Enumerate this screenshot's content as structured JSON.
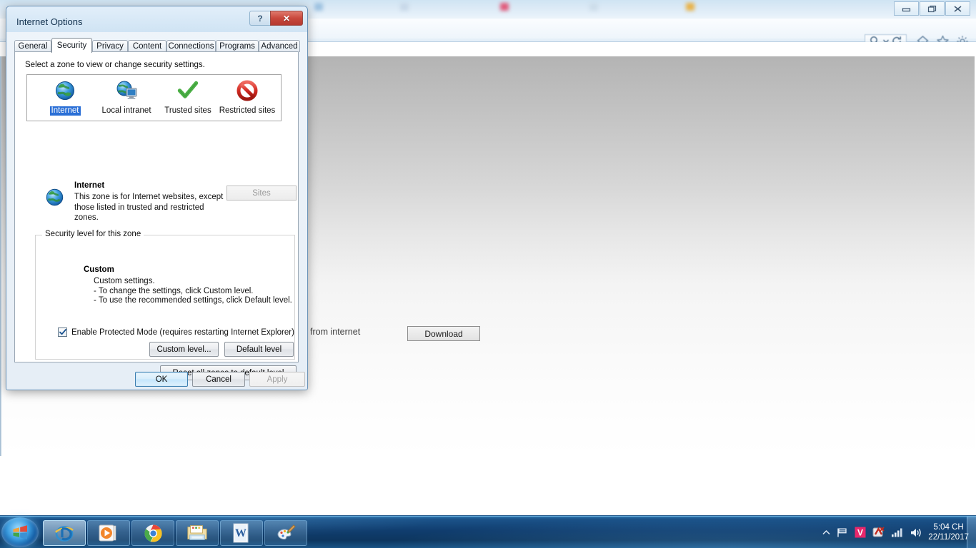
{
  "browser": {
    "window_controls": [
      {
        "name": "minimize",
        "glyph": "–"
      },
      {
        "name": "restore",
        "glyph": "❐"
      },
      {
        "name": "close",
        "glyph": "✕"
      }
    ],
    "tabs": [
      {
        "label": "",
        "blurred": true
      },
      {
        "label": "",
        "blurred": true
      },
      {
        "label": "",
        "blurred": true
      },
      {
        "label": "",
        "blurred": true
      },
      {
        "label": "",
        "blurred": true
      }
    ],
    "toolbar_icons": [
      "search-icon",
      "chevron-down-icon",
      "refresh-icon",
      "home-icon",
      "favorites-star-icon",
      "settings-gear-icon"
    ]
  },
  "page": {
    "text_fragment": "from internet",
    "download_button": "Download"
  },
  "dialog": {
    "title": "Internet Options",
    "caption_buttons": {
      "help": "?",
      "close": "✕"
    },
    "tabs": [
      {
        "label": "General",
        "active": false
      },
      {
        "label": "Security",
        "active": true
      },
      {
        "label": "Privacy",
        "active": false
      },
      {
        "label": "Content",
        "active": false
      },
      {
        "label": "Connections",
        "active": false
      },
      {
        "label": "Programs",
        "active": false
      },
      {
        "label": "Advanced",
        "active": false
      }
    ],
    "security": {
      "instruction": "Select a zone to view or change security settings.",
      "zones": [
        {
          "label": "Internet",
          "icon": "globe-icon",
          "selected": true
        },
        {
          "label": "Local intranet",
          "icon": "globe-monitor-icon",
          "selected": false
        },
        {
          "label": "Trusted sites",
          "icon": "green-check-icon",
          "selected": false
        },
        {
          "label": "Restricted sites",
          "icon": "red-prohibition-icon",
          "selected": false
        }
      ],
      "selected_zone_name": "Internet",
      "selected_zone_description": "This zone is for Internet websites, except those listed in trusted and restricted zones.",
      "sites_button": "Sites",
      "sites_button_enabled": false,
      "level_group_legend": "Security level for this zone",
      "level_name": "Custom",
      "level_lines": [
        "Custom settings.",
        "- To change the settings, click Custom level.",
        "- To use the recommended settings, click Default level."
      ],
      "protected_mode": {
        "label": "Enable Protected Mode (requires restarting Internet Explorer)",
        "checked": true
      },
      "custom_level_button": "Custom level...",
      "default_level_button": "Default level",
      "reset_button": "Reset all zones to default level"
    },
    "footer": {
      "ok": "OK",
      "cancel": "Cancel",
      "apply": "Apply",
      "apply_enabled": false
    }
  },
  "taskbar": {
    "start_button": "start-orb",
    "items": [
      {
        "name": "internet-explorer",
        "active": true
      },
      {
        "name": "windows-media-player",
        "active": false
      },
      {
        "name": "google-chrome",
        "active": false
      },
      {
        "name": "windows-explorer",
        "active": false
      },
      {
        "name": "microsoft-word",
        "active": false
      },
      {
        "name": "paint",
        "active": false
      }
    ],
    "tray_icons": [
      "show-hidden-icons-arrow",
      "action-center-flag",
      "v-antivirus-icon",
      "unikey-icon",
      "network-signal-icon",
      "volume-icon"
    ],
    "clock_time": "5:04 CH",
    "clock_date": "22/11/2017"
  },
  "colors": {
    "accent": "#2a6fd6",
    "close_red": "#c9483c",
    "taskbar_blue": "#103d6e"
  }
}
